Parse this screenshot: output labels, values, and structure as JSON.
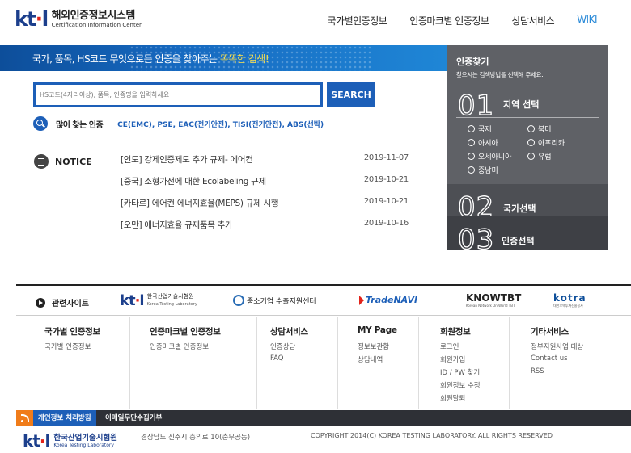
{
  "header": {
    "logo_mark": "ktl",
    "logo_title": "해외인증정보시스템",
    "logo_subtitle": "Certification Information Center",
    "nav": [
      "국가별인증정보",
      "인증마크별 인증정보",
      "상담서비스",
      "WIKI"
    ],
    "active_nav_color": "#2a8ad8"
  },
  "banner": {
    "text_before": "국가, 품목, HS코드 무엇으로든 인증을 찾아주는 ",
    "text_highlight": "똑똑한 검색!"
  },
  "search": {
    "placeholder": "HS코드(4자리이상), 품목, 인증명을 입력하세요",
    "button_label": "SEARCH",
    "popular_label": "많이 찾는 인증",
    "popular_links": "CE(EMC), PSE, EAC(전기안전), TISI(전기안전), ABS(선박)"
  },
  "notice": {
    "label": "NOTICE",
    "items": [
      {
        "title": "[인도] 강제인증제도 추가 규제- 에어컨",
        "date": "2019-11-07"
      },
      {
        "title": "[중국] 소형가전에 대한 Ecolabeling 규제",
        "date": "2019-10-21"
      },
      {
        "title": "[카타르] 에어컨 에너지효율(MEPS) 규제 시행",
        "date": "2019-10-21"
      },
      {
        "title": "[오만] 에너지효율 규제품목 추가",
        "date": "2019-10-16"
      }
    ]
  },
  "panel": {
    "title": "인증찾기",
    "subtitle": "찾으시는 검색방법을 선택해 주세요.",
    "steps": [
      {
        "num": "01",
        "label": "지역 선택"
      },
      {
        "num": "02",
        "label": "국가선택"
      },
      {
        "num": "03",
        "label": "인증선택"
      }
    ],
    "regions": [
      "국제",
      "북미",
      "아시아",
      "아프리카",
      "오세아니아",
      "유럽",
      "중남미"
    ]
  },
  "related": {
    "label": "관련사이트",
    "sites": {
      "ktl_mark": "ktl",
      "ktl_name": "한국산업기술시험원",
      "ktl_sub": "Korea Testing Laboratory",
      "sbiz": "중소기업 수출지원센터",
      "tradenavi": "TradeNAVI",
      "knowtbt": "KNOWTBT",
      "knowtbt_sub": "Korean Network On World TBT",
      "kotra": "kotra",
      "kotra_sub": "대한무역투자진흥공사"
    }
  },
  "footer_menu": [
    {
      "title": "국가별 인증정보",
      "links": [
        "국가별 인증정보"
      ]
    },
    {
      "title": "인증마크별 인증정보",
      "links": [
        "인증마크별 인증정보"
      ]
    },
    {
      "title": "상담서비스",
      "links": [
        "인증상담",
        "FAQ"
      ]
    },
    {
      "title": "MY Page",
      "links": [
        "정보보관함",
        "상담내역"
      ]
    },
    {
      "title": "회원정보",
      "links": [
        "로그인",
        "회원가입",
        "ID / PW 찾기",
        "회원정보 수정",
        "회원탈퇴"
      ]
    },
    {
      "title": "기타서비스",
      "links": [
        "정부지원사업 대상",
        "Contact us",
        "RSS"
      ]
    }
  ],
  "bottom_bar": {
    "privacy": "개인정보 처리방침",
    "email_refuse": "이메일무단수집거부"
  },
  "copyright": {
    "logo_mark": "ktl",
    "name_kr": "한국산업기술시험원",
    "name_en": "Korea Testing Laboratory",
    "address": "경상남도 진주시 충의로 10(충무공동)",
    "text": "COPYRIGHT 2014(C) KOREA TESTING LABORATORY. ALL RIGHTS RESERVED"
  },
  "colors": {
    "brand_blue": "#1d5fb8",
    "banner_highlight": "#ffe24a",
    "panel_bg": "#5f6166",
    "rss_orange": "#f07c1a"
  }
}
